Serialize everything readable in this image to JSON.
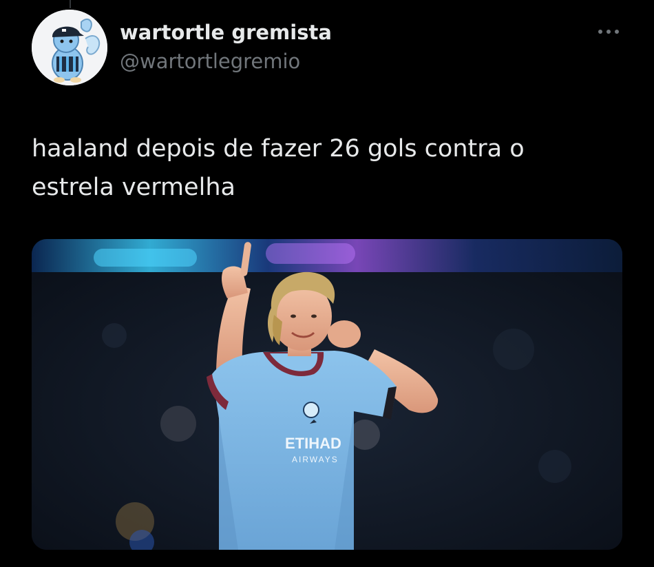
{
  "tweet": {
    "author": {
      "display_name": "wartortle gremista",
      "handle": "@wartortlegremio",
      "avatar_icon": "wartortle-avatar-icon"
    },
    "more_icon": "more-horizontal-icon",
    "text": "haaland depois de fazer 26 gols contra o\nestrela vermelha",
    "media": {
      "kit_sponsor_line1": "ETIHAD",
      "kit_sponsor_line2": "AIRWAYS"
    }
  },
  "colors": {
    "background": "#000000",
    "primary_text": "#e7e9ea",
    "secondary_text": "#71767b",
    "jersey": "#7bb3e0",
    "stadium_lights": "#38c6f2"
  }
}
